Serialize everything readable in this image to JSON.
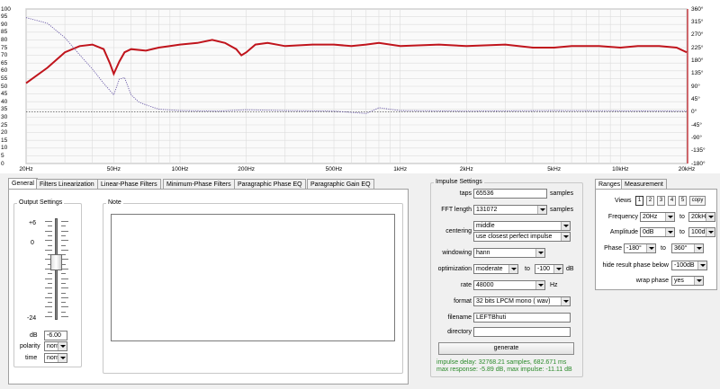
{
  "plot": {
    "y_ticks": [
      "100",
      "95",
      "90",
      "85",
      "80",
      "75",
      "70",
      "65",
      "60",
      "55",
      "50",
      "45",
      "40",
      "35",
      "30",
      "25",
      "20",
      "15",
      "10",
      "5",
      "0"
    ],
    "phase_ticks": [
      "360°",
      "315°",
      "270°",
      "225°",
      "180°",
      "135°",
      "90°",
      "45°",
      "0°",
      "-45°",
      "-90°",
      "-135°",
      "-180°"
    ],
    "freq_ticks": [
      "20Hz",
      "50Hz",
      "100Hz",
      "200Hz",
      "500Hz",
      "1kHz",
      "2kHz",
      "5kHz",
      "10kHz",
      "20kHz"
    ],
    "colors": {
      "magnitude": "#c0141c",
      "phase": "#6a5aa8",
      "grid": "#dcdcdc",
      "zero_line": "#333333"
    }
  },
  "chart_data": {
    "type": "line",
    "x_scale": "log",
    "xlim": [
      20,
      20000
    ],
    "ylim": [
      0,
      100
    ],
    "y2lim": [
      -180,
      360
    ],
    "grid": true,
    "series": [
      {
        "axis": "left",
        "style": "solid",
        "x": [
          20,
          25,
          30,
          35,
          40,
          45,
          48,
          50,
          53,
          56,
          60,
          70,
          80,
          90,
          100,
          120,
          140,
          160,
          180,
          190,
          200,
          220,
          250,
          300,
          400,
          500,
          600,
          700,
          800,
          1000,
          1500,
          2000,
          3000,
          4000,
          5000,
          6000,
          8000,
          10000,
          12000,
          15000,
          18000,
          20000
        ],
        "y": [
          52,
          62,
          72,
          76,
          77,
          74,
          65,
          58,
          66,
          72,
          74,
          73,
          75,
          76,
          77,
          78,
          80,
          78,
          74,
          70,
          72,
          77,
          78,
          76,
          77,
          77,
          76,
          77,
          78,
          76,
          77,
          76,
          77,
          75,
          75,
          76,
          76,
          75,
          76,
          76,
          75,
          72
        ]
      },
      {
        "axis": "right",
        "style": "dotted",
        "x": [
          20,
          25,
          30,
          35,
          40,
          45,
          50,
          53,
          56,
          60,
          65,
          70,
          80,
          100,
          150,
          200,
          300,
          500,
          700,
          800,
          1000,
          2000,
          5000,
          10000,
          20000
        ],
        "y": [
          330,
          310,
          260,
          200,
          150,
          100,
          60,
          115,
          120,
          60,
          35,
          25,
          10,
          5,
          3,
          8,
          5,
          3,
          -5,
          15,
          5,
          3,
          5,
          4,
          3
        ]
      }
    ]
  },
  "tabs": [
    "General",
    "Filters Linearization",
    "Linear-Phase Filters",
    "Minimum-Phase Filters",
    "Paragraphic Phase EQ",
    "Paragraphic Gain EQ"
  ],
  "output": {
    "title": "Output Settings",
    "scale_top": "+6",
    "scale_mid": "0",
    "scale_bottom": "-24",
    "db_label": "dB",
    "db_value": "-6.00",
    "polarity_label": "polarity",
    "polarity_value": "norm",
    "time_label": "time",
    "time_value": "norm"
  },
  "note": {
    "title": "Note",
    "value": ""
  },
  "impulse": {
    "title": "Impulse Settings",
    "taps_label": "taps",
    "taps_value": "65536",
    "taps_unit": "samples",
    "fft_label": "FFT length",
    "fft_value": "131072",
    "fft_unit": "samples",
    "centering_label": "centering",
    "centering_value1": "middle",
    "centering_value2": "use closest perfect impulse",
    "windowing_label": "windowing",
    "windowing_value": "hann",
    "optimization_label": "optimization",
    "optimization_value": "moderate",
    "optimization_to": "to",
    "optimization_limit": "-100",
    "optimization_unit": "dB",
    "rate_label": "rate",
    "rate_value": "48000",
    "rate_unit": "Hz",
    "format_label": "format",
    "format_value": "32 bits LPCM mono ( wav)",
    "filename_label": "filename",
    "filename_value": "LEFTBhuti",
    "directory_label": "directory",
    "directory_value": "",
    "generate_label": "generate",
    "status_line1": "impulse delay: 32768.21 samples, 682.671 ms",
    "status_line2": "max response: -5.89 dB, max impulse: -11.11 dB"
  },
  "ranges": {
    "tab_ranges": "Ranges",
    "tab_measurement": "Measurement",
    "views_label": "Views",
    "views": [
      "1",
      "2",
      "3",
      "4",
      "5"
    ],
    "copy_label": "copy",
    "frequency_label": "Frequency",
    "freq_from": "20Hz",
    "freq_to_label": "to",
    "freq_to": "20kHz",
    "amplitude_label": "Amplitude",
    "amp_from": "0dB",
    "amp_to_label": "to",
    "amp_to": "100dB",
    "phase_label": "Phase",
    "phase_from": "-180°",
    "phase_to_label": "to",
    "phase_to": "360°",
    "hide_label": "hide result phase below",
    "hide_value": "-100dB",
    "wrap_label": "wrap phase",
    "wrap_value": "yes"
  }
}
